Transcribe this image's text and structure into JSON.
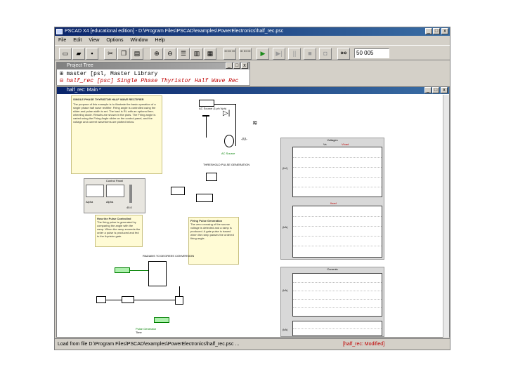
{
  "window": {
    "title": "PSCAD X4 [educational edition] - D:\\Program Files\\PSCAD\\examples\\PowerElectronics\\half_rec.psc",
    "min": "_",
    "max": "□",
    "close": "x"
  },
  "menu": [
    "File",
    "Edit",
    "View",
    "Options",
    "Window",
    "Help"
  ],
  "toolbar": {
    "icons": [
      "new-icon",
      "open-icon",
      "save-icon",
      "cut-icon",
      "copy-icon",
      "paste-icon",
      "zoom-in-icon",
      "zoom-out-icon",
      "layers-icon",
      "settings-icon",
      "grid-icon"
    ],
    "sim_controls": [
      "play-icon",
      "step-icon",
      "pause-icon",
      "stop-icon",
      "snapshot-icon"
    ],
    "time_value": "50 005"
  },
  "project_tree": {
    "title": "Project Tree",
    "items": [
      {
        "label": "master [psl, Master Library",
        "color": "#000000"
      },
      {
        "label": "half_rec [psc] Single Phase Thyristor Half Wave Rec",
        "color": "#c00000"
      }
    ]
  },
  "main_window": {
    "title": "half_rec: Main *"
  },
  "status": {
    "load_text": "Load from file D:\\Program Files\\PSCAD\\examples\\PowerElectronics\\half_rec.psc ...",
    "modified": "[half_rec: Modified]"
  },
  "canvas": {
    "note1": {
      "heading": "SINGLE PHASE THYRISTOR HALF WAVE RECTIFIER",
      "body": "The purpose of this example is to illustrate the basic operation of a single phase half wave rectifier. Firing angle is controlled using the slider and pulse width is set. The load is RL with an optional free-wheeling diode. Results are shown in the plots. The Firing angle is varied using the Firing Angle slider on the control panel, and the voltage and current waveforms are plotted below."
    },
    "source_label": "AC Source (1 ph Vph)",
    "panel": {
      "title": "Control Panel",
      "labels": [
        "Alpha",
        "Alpha",
        "Alpha Order"
      ],
      "value": "45.0"
    },
    "pulse_label": "THRESHOLD PULSE GENERATION",
    "note2": {
      "heading": "How the Pulse Controlled",
      "body": "The firing pulse is generated by comparing the angle with the ramp. When the ramp exceeds the order a pulse is produced and fed to the thyristor gate."
    },
    "note3": {
      "heading": "Firing Pulse Generation",
      "body": "The zero crossing of the source voltage is detected and a ramp is produced. A gate pulse is issued when the ramp passes the ordered firing angle."
    },
    "conv_label": "RADIANS TO DEGREES CONVERSION",
    "pulse_block": "Pulse Generator",
    "time_label": "Time",
    "plots": [
      {
        "title": "Voltages",
        "legend": [
          "Vs",
          "Vload"
        ],
        "ylabel": "(kV)"
      },
      {
        "title": "",
        "legend": [
          "Iload"
        ],
        "ylabel": "(kA)"
      },
      {
        "title": "Currents",
        "legend": [],
        "ylabel": "(kA)"
      },
      {
        "title": "",
        "legend": [],
        "ylabel": "(kA)"
      }
    ],
    "colors": {
      "wire": "#000000",
      "signal": "#008000",
      "note_bg": "#fffbd5",
      "accent": "#c00000"
    }
  }
}
